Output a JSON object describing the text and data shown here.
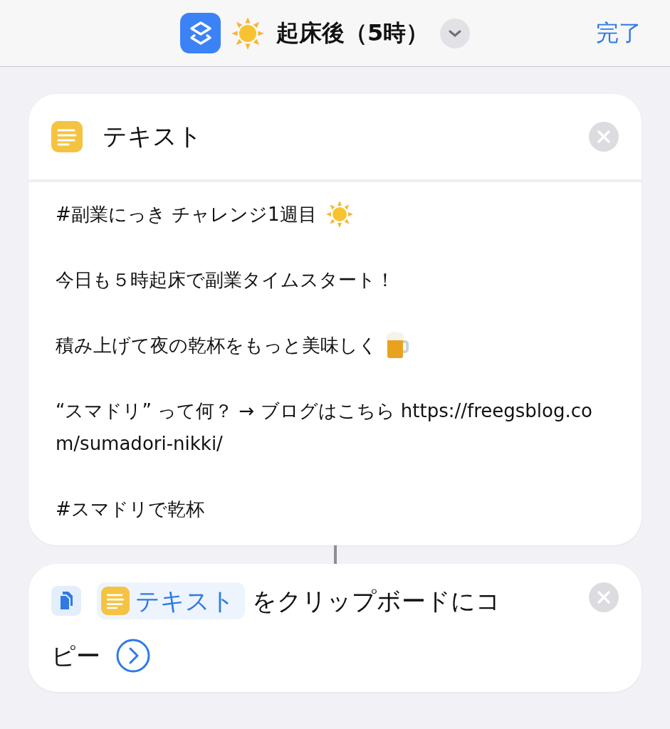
{
  "header": {
    "title": "起床後（5時）",
    "done": "完了"
  },
  "actions": [
    {
      "kind": "text",
      "title": "テキスト",
      "paragraphs": [
        {
          "kind": "sun",
          "text": "#副業にっき チャレンジ1週目"
        },
        {
          "kind": "plain",
          "text": "今日も５時起床で副業タイムスタート！"
        },
        {
          "kind": "beer",
          "text": "積み上げて夜の乾杯をもっと美味しく"
        },
        {
          "kind": "plain",
          "text": "“スマドリ” って何？ → ブログはこちら https://freegsblog.com/sumadori-nikki/"
        },
        {
          "kind": "plain",
          "text": "#スマドリで乾杯"
        }
      ]
    },
    {
      "kind": "copy",
      "token": "テキスト",
      "label_lines": [
        "をクリップボードにコ",
        "ピー"
      ]
    }
  ]
}
